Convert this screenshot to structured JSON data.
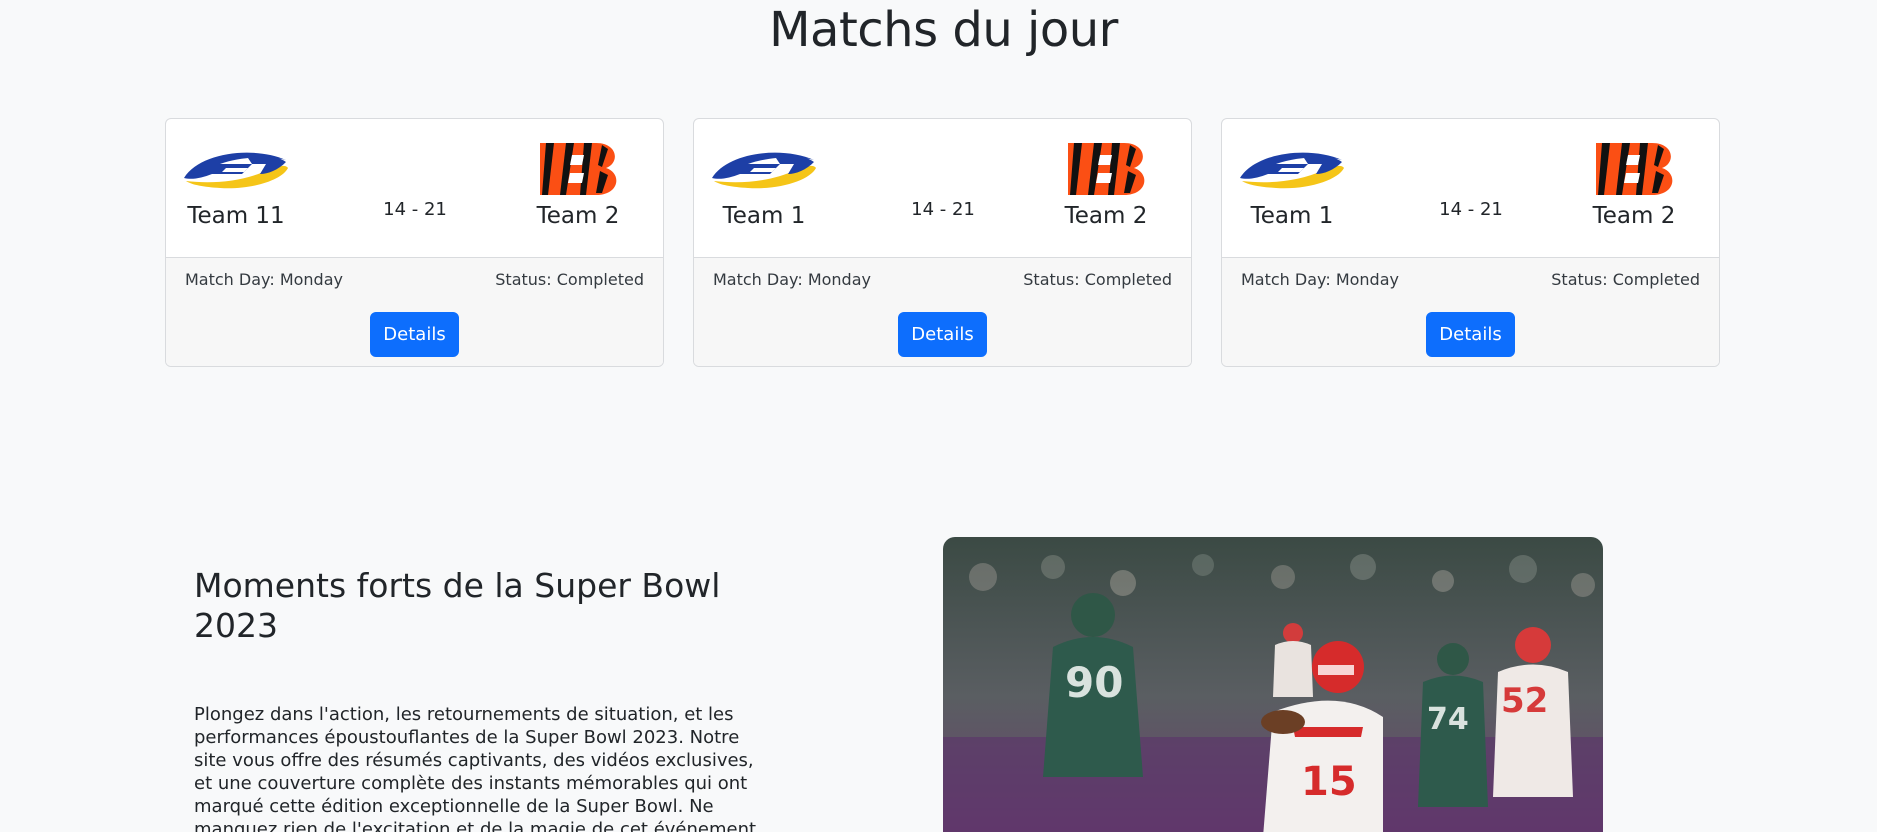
{
  "page": {
    "title": "Matchs du jour"
  },
  "matches": [
    {
      "home_team": "Team 11",
      "away_team": "Team 2",
      "score": "14 - 21",
      "match_day": "Match Day: Monday",
      "status": "Status: Completed",
      "details_label": "Details",
      "home_logo": "rams-logo",
      "away_logo": "bengals-logo"
    },
    {
      "home_team": "Team 1",
      "away_team": "Team 2",
      "score": "14 - 21",
      "match_day": "Match Day: Monday",
      "status": "Status: Completed",
      "details_label": "Details",
      "home_logo": "rams-logo",
      "away_logo": "bengals-logo"
    },
    {
      "home_team": "Team 1",
      "away_team": "Team 2",
      "score": "14 - 21",
      "match_day": "Match Day: Monday",
      "status": "Status: Completed",
      "details_label": "Details",
      "home_logo": "rams-logo",
      "away_logo": "bengals-logo"
    }
  ],
  "highlights": {
    "title": "Moments forts de la Super Bowl 2023",
    "text": "Plongez dans l'action, les retournements de situation, et les performances époustouflantes de la Super Bowl 2023. Notre site vous offre des résumés captivants, des vidéos exclusives, et une couverture complète des instants mémorables qui ont marqué cette édition exceptionnelle de la Super Bowl. Ne manquez rien de l'excitation et de la magie de cet événement sportif."
  },
  "colors": {
    "primary": "#0d6efd",
    "background": "#f8f9fa",
    "rams_blue": "#1d3fa6",
    "rams_gold": "#f5c518",
    "bengals_orange": "#fb4f14",
    "bengals_black": "#111111"
  }
}
